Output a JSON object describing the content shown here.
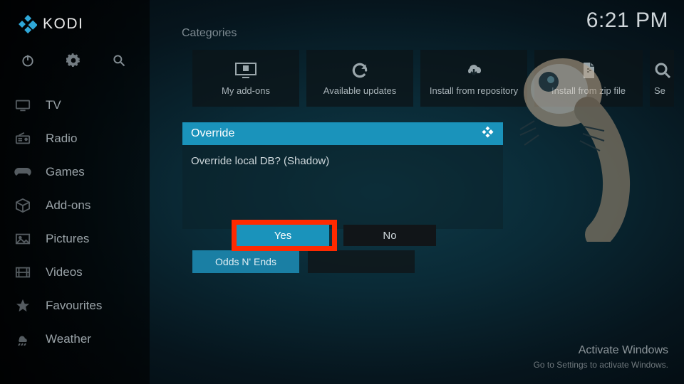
{
  "brand": {
    "name": "KODI"
  },
  "clock": "6:21 PM",
  "sidebar": {
    "items": [
      {
        "label": "TV"
      },
      {
        "label": "Radio"
      },
      {
        "label": "Games"
      },
      {
        "label": "Add-ons"
      },
      {
        "label": "Pictures"
      },
      {
        "label": "Videos"
      },
      {
        "label": "Favourites"
      },
      {
        "label": "Weather"
      }
    ]
  },
  "categories": {
    "heading": "Categories",
    "items": [
      {
        "label": "My add-ons"
      },
      {
        "label": "Available updates"
      },
      {
        "label": "Install from repository"
      },
      {
        "label": "Install from zip file"
      },
      {
        "label": "Se"
      }
    ]
  },
  "dialog": {
    "title": "Override",
    "message": "Override local DB? (Shadow)",
    "yes": "Yes",
    "no": "No"
  },
  "leftover": {
    "odds": "Odds N' Ends"
  },
  "watermark": {
    "title": "Activate Windows",
    "sub": "Go to Settings to activate Windows."
  }
}
